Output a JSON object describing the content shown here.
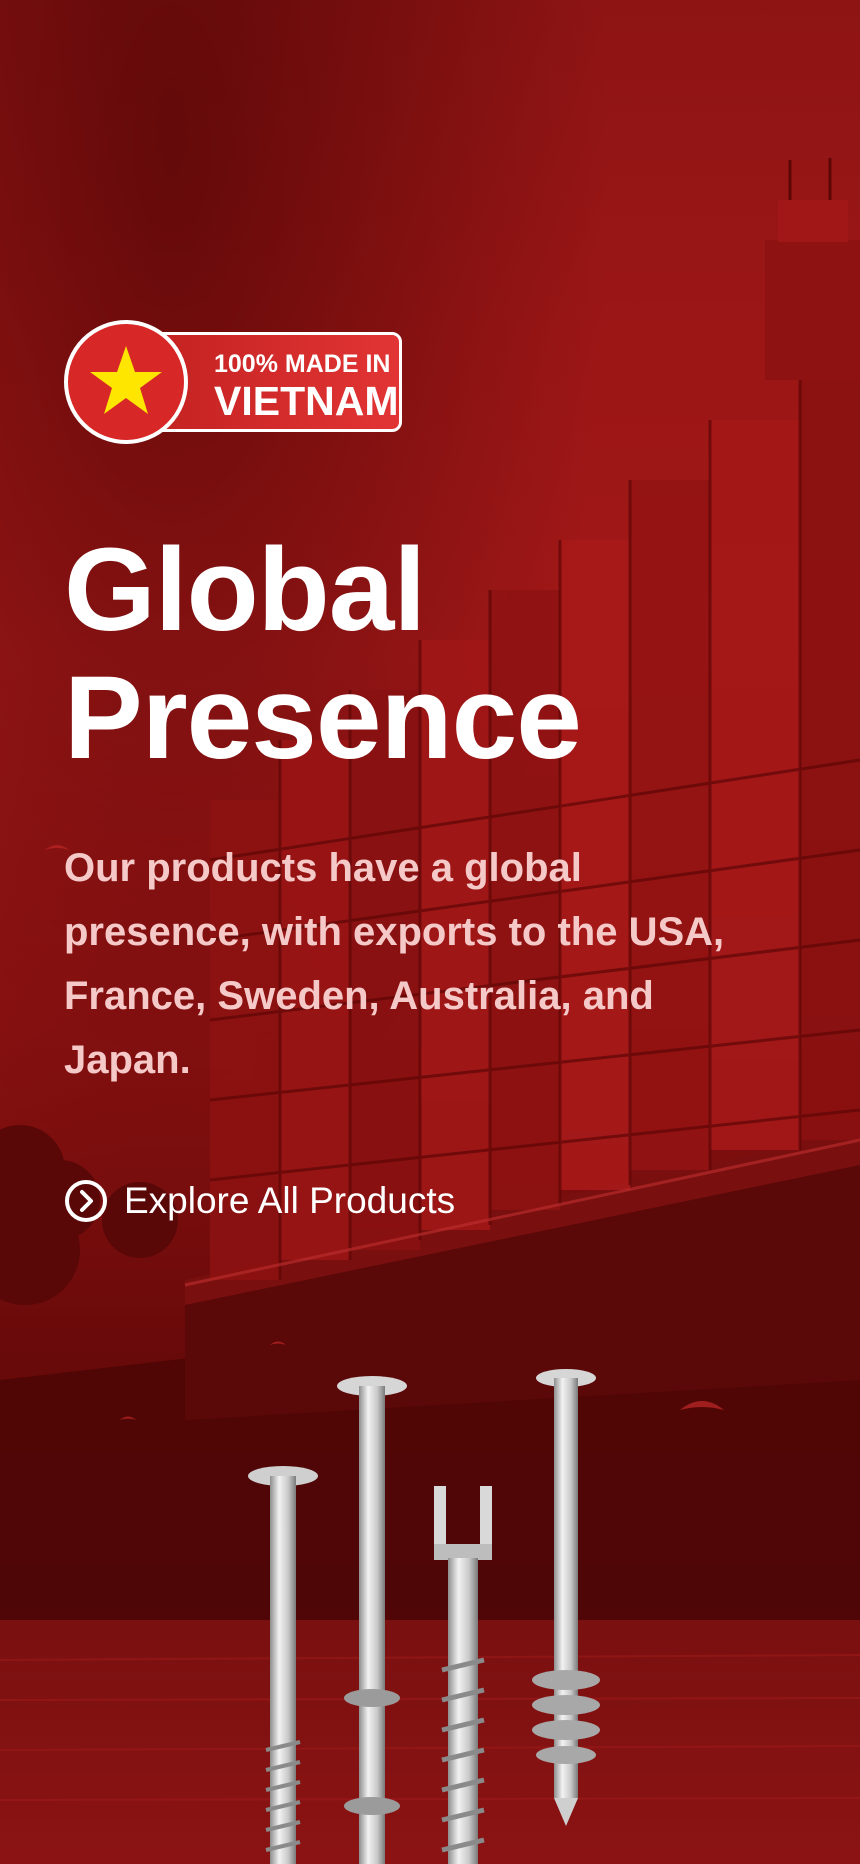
{
  "badge": {
    "line1": "100% MADE IN",
    "line2": "VIETNAM",
    "icon": "vietnam-flag-star-icon"
  },
  "hero": {
    "title_line1": "Global",
    "title_line2": "Presence",
    "description": "Our products have a global presence, with exports to the USA, France, Sweden, Australia, and Japan."
  },
  "cta": {
    "label": "Explore All Products",
    "icon": "chevron-right-circle-icon"
  },
  "colors": {
    "background": "#9c1616",
    "badge_red": "#d72727",
    "star_yellow": "#ffe600",
    "description_text": "#f6c9c9",
    "white": "#ffffff"
  }
}
